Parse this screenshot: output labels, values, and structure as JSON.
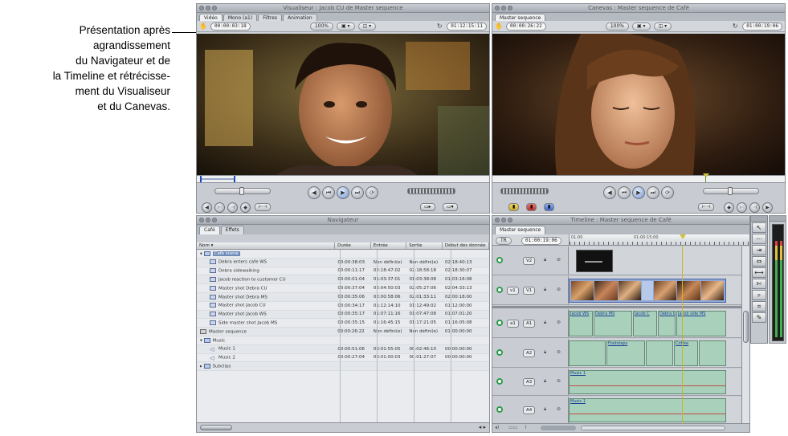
{
  "caption": {
    "lines": [
      "Présentation après",
      "agrandissement",
      "du Navigateur et de",
      "la Timeline et rétrécisse-",
      "ment du Visualiseur",
      "et du Canevas."
    ]
  },
  "viewer": {
    "title": "Visualiseur : Jacob CU de Master sequence",
    "tabs": [
      "Vidéo",
      "Mono (a1)",
      "Filtres",
      "Animation"
    ],
    "timecode_left": "00:00:03:18",
    "zoom": "100%",
    "timecode_right": "01:12:15:11"
  },
  "canvas": {
    "title": "Canevas : Master sequence de Café",
    "tab": "Master sequence",
    "timecode_left": "00:00:26:22",
    "zoom": "100%",
    "timecode_right": "01:00:19:06"
  },
  "browser": {
    "title": "Navigateur",
    "tabs": [
      "Café",
      "Effets"
    ],
    "columns": [
      "Nom",
      "Durée",
      "Entrée",
      "Sortie",
      "Début des donnée"
    ],
    "rows": [
      {
        "indent": 0,
        "icon": "folder",
        "name": "Cafe scene",
        "dur": "",
        "in": "",
        "out": "",
        "start": "",
        "selected": true
      },
      {
        "indent": 1,
        "icon": "clip",
        "name": "Debra enters cafe WS",
        "dur": "00:00:38:03",
        "in": "Non défini(e)",
        "out": "Non défini(e)",
        "start": "02:18:40:13"
      },
      {
        "indent": 1,
        "icon": "clip",
        "name": "Debra sidewalking",
        "dur": "00:00:11:17",
        "in": "02:18:47:02",
        "out": "02:18:58:18",
        "start": "02:18:30:07"
      },
      {
        "indent": 1,
        "icon": "clip",
        "name": "Jacob reaction to customer CU",
        "dur": "00:00:01:04",
        "in": "01:03:37:01",
        "out": "01:03:38:08",
        "start": "01:03:16:08"
      },
      {
        "indent": 1,
        "icon": "clip",
        "name": "Master shot Debra CU",
        "dur": "00:00:37:04",
        "in": "02:04:50:03",
        "out": "02:05:27:06",
        "start": "02:04:33:13"
      },
      {
        "indent": 1,
        "icon": "clip",
        "name": "Master shot Debra MS",
        "dur": "00:00:35:06",
        "in": "02:00:58:06",
        "out": "02:01:33:11",
        "start": "02:00:18:00"
      },
      {
        "indent": 1,
        "icon": "clip",
        "name": "Master shot Jacob CU",
        "dur": "00:00:34:17",
        "in": "01:12:14:10",
        "out": "01:12:49:02",
        "start": "01:12:00:00"
      },
      {
        "indent": 1,
        "icon": "clip",
        "name": "Master shot Jacob WS",
        "dur": "00:00:35:17",
        "in": "01:07:11:16",
        "out": "01:07:47:08",
        "start": "01:07:01:20"
      },
      {
        "indent": 1,
        "icon": "clip",
        "name": "Side master shot Jacob MS",
        "dur": "00:00:35:15",
        "in": "01:16:45:15",
        "out": "01:17:21:05",
        "start": "01:16:05:08"
      },
      {
        "indent": 0,
        "icon": "seq",
        "name": "Master sequence",
        "dur": "00:00:26:22",
        "in": "Non défini(e)",
        "out": "Non défini(e)",
        "start": "01:00:00:00"
      },
      {
        "indent": 0,
        "icon": "folder",
        "name": "Music",
        "dur": "",
        "in": "",
        "out": "",
        "start": ""
      },
      {
        "indent": 1,
        "icon": "music",
        "name": "Music 1",
        "dur": "00:00:51:06",
        "in": "00:01:55:05",
        "out": "00:02:46:10",
        "start": "00:00:00:00"
      },
      {
        "indent": 1,
        "icon": "music",
        "name": "Music 2",
        "dur": "00:00:27:04",
        "in": "00:01:00:03",
        "out": "00:01:27:07",
        "start": "00:00:00:00"
      },
      {
        "indent": 0,
        "icon": "folder",
        "name": "Subclips",
        "dur": "",
        "in": "",
        "out": "",
        "start": ""
      }
    ]
  },
  "timeline": {
    "title": "Timeline : Master sequence de Café",
    "tab": "Master sequence",
    "mode": "TR",
    "timecode": "01:00:19:06",
    "ruler": [
      "01:00",
      "01:00:15:00"
    ],
    "tracks": {
      "v2": "V2",
      "v1_src": "v1",
      "v1": "V1",
      "a1_src": "a1",
      "a1": "A1",
      "a2": "A2",
      "a3": "A3",
      "a4": "A4"
    },
    "a1_clips": [
      "Jacob WS",
      "Debra MS",
      "Jacob C",
      "Debra C",
      "Jacob side MS"
    ],
    "a2_clips": [
      "Footsteps",
      "Coffee"
    ],
    "music_label": "Music 1"
  },
  "tools": [
    "select-icon",
    "edit-select-icon",
    "track-select-icon",
    "roll-icon",
    "slip-icon",
    "razor-icon",
    "zoom-icon",
    "crop-icon",
    "pen-icon"
  ]
}
